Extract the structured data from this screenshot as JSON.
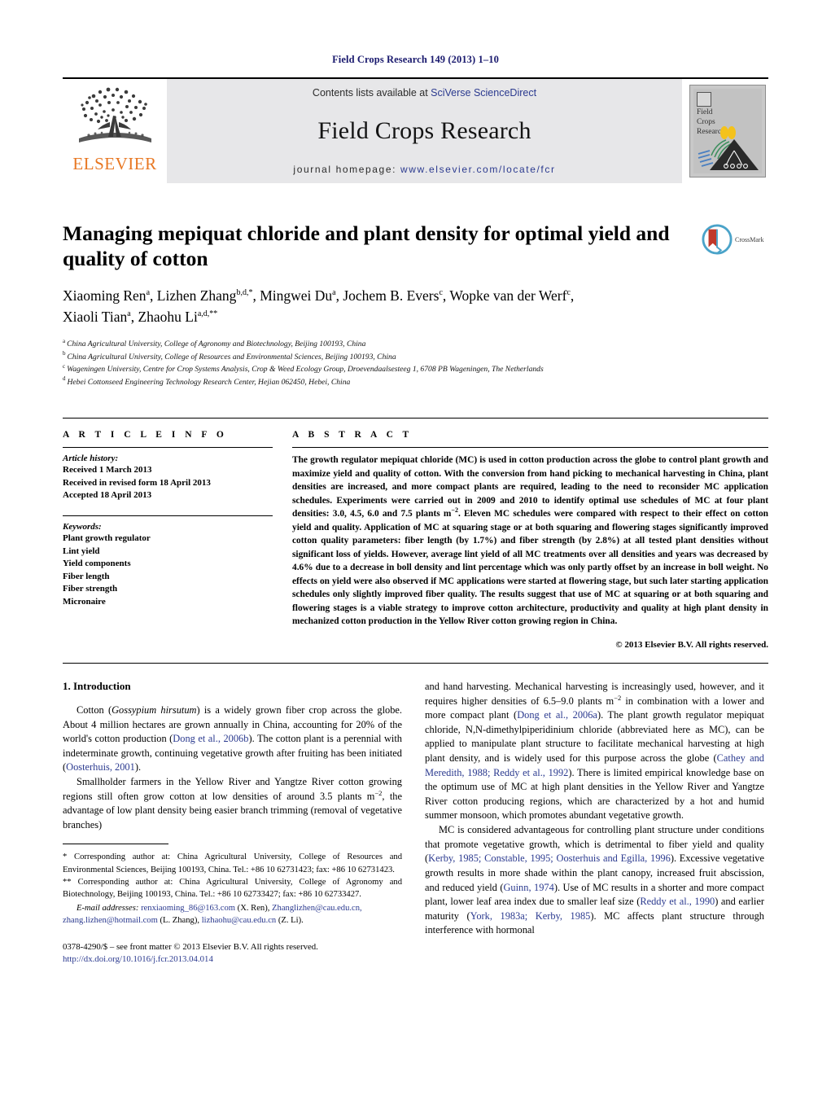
{
  "running_head": "Field Crops Research 149 (2013) 1–10",
  "masthead": {
    "publisher_name": "ELSEVIER",
    "contents_prefix": "Contents lists available at ",
    "contents_link": "SciVerse ScienceDirect",
    "journal_title": "Field Crops Research",
    "homepage_prefix": "journal homepage: ",
    "homepage_url": "www.elsevier.com/locate/fcr",
    "cover_title_line1": "Field",
    "cover_title_line2": "Crops",
    "cover_title_line3": "Research"
  },
  "article": {
    "title": "Managing mepiquat chloride and plant density for optimal yield and quality of cotton",
    "crossmark_label": "CrossMark",
    "authors_line1": "Xiaoming Ren|a|, Lizhen Zhang|b,d,*|, Mingwei Du|a|, Jochem B. Evers|c|, Wopke van der Werf|c|,",
    "authors_line2": "Xiaoli Tian|a|, Zhaohu Li|a,d,**|",
    "affiliations": [
      {
        "mark": "a",
        "text": "China Agricultural University, College of Agronomy and Biotechnology, Beijing 100193, China"
      },
      {
        "mark": "b",
        "text": "China Agricultural University, College of Resources and Environmental Sciences, Beijing 100193, China"
      },
      {
        "mark": "c",
        "text": "Wageningen University, Centre for Crop Systems Analysis, Crop & Weed Ecology Group, Droevendaalsesteeg 1, 6708 PB Wageningen, The Netherlands"
      },
      {
        "mark": "d",
        "text": "Hebei Cottonseed Engineering Technology Research Center, Hejian 062450, Hebei, China"
      }
    ]
  },
  "article_info": {
    "heading": "A R T I C L E  I N F O",
    "history_label": "Article history:",
    "history": [
      "Received 1 March 2013",
      "Received in revised form 18 April 2013",
      "Accepted 18 April 2013"
    ],
    "keywords_label": "Keywords:",
    "keywords": [
      "Plant growth regulator",
      "Lint yield",
      "Yield components",
      "Fiber length",
      "Fiber strength",
      "Micronaire"
    ]
  },
  "abstract": {
    "heading": "A B S T R A C T",
    "text_part1": "The growth regulator mepiquat chloride (MC) is used in cotton production across the globe to control plant growth and maximize yield and quality of cotton. With the conversion from hand picking to mechanical harvesting in China, plant densities are increased, and more compact plants are required, leading to the need to reconsider MC application schedules. Experiments were carried out in 2009 and 2010 to identify optimal use schedules of MC at four plant densities: 3.0, 4.5, 6.0 and 7.5 plants m",
    "sup1": "−2",
    "text_part2": ". Eleven MC schedules were compared with respect to their effect on cotton yield and quality. Application of MC at squaring stage or at both squaring and flowering stages significantly improved cotton quality parameters: fiber length (by 1.7%) and fiber strength (by 2.8%) at all tested plant densities without significant loss of yields. However, average lint yield of all MC treatments over all densities and years was decreased by 4.6% due to a decrease in boll density and lint percentage which was only partly offset by an increase in boll weight. No effects on yield were also observed if MC applications were started at flowering stage, but such later starting application schedules only slightly improved fiber quality. The results suggest that use of MC at squaring or at both squaring and flowering stages is a viable strategy to improve cotton architecture, productivity and quality at high plant density in mechanized cotton production in the Yellow River cotton growing region in China.",
    "copyright": "© 2013 Elsevier B.V. All rights reserved."
  },
  "introduction": {
    "heading": "1.  Introduction",
    "left": {
      "p1_a": "Cotton (",
      "p1_italic": "Gossypium hirsutum",
      "p1_b": ") is a widely grown fiber crop across the globe. About 4 million hectares are grown annually in China, accounting for 20% of the world's cotton production (",
      "p1_ref1": "Dong et al., 2006b",
      "p1_c": "). The cotton plant is a perennial with indeterminate growth, continuing vegetative growth after fruiting has been initiated (",
      "p1_ref2": "Oosterhuis, 2001",
      "p1_d": ").",
      "p2_a": "Smallholder farmers in the Yellow River and Yangtze River cotton growing regions still often grow cotton at low densities of around 3.5 plants m",
      "p2_sup": "−2",
      "p2_b": ", the advantage of low plant density being easier branch trimming (removal of vegetative branches)"
    },
    "right": {
      "p1_a": "and hand harvesting. Mechanical harvesting is increasingly used, however, and it requires higher densities of 6.5–9.0 plants m",
      "p1_sup": "−2",
      "p1_b": " in combination with a lower and more compact plant (",
      "p1_ref1": "Dong et al., 2006a",
      "p1_c": "). The plant growth regulator mepiquat chloride, N,N-dimethylpiperidinium chloride (abbreviated here as MC), can be applied to manipulate plant structure to facilitate mechanical harvesting at high plant density, and is widely used for this purpose across the globe (",
      "p1_ref2": "Cathey and Meredith, 1988; Reddy et al., 1992",
      "p1_d": "). There is limited empirical knowledge base on the optimum use of MC at high plant densities in the Yellow River and Yangtze River cotton producing regions, which are characterized by a hot and humid summer monsoon, which promotes abundant vegetative growth.",
      "p2_a": "MC is considered advantageous for controlling plant structure under conditions that promote vegetative growth, which is detrimental to fiber yield and quality (",
      "p2_ref1": "Kerby, 1985; Constable, 1995; Oosterhuis and Egilla, 1996",
      "p2_b": "). Excessive vegetative growth results in more shade within the plant canopy, increased fruit abscission, and reduced yield (",
      "p2_ref2": "Guinn, 1974",
      "p2_c": "). Use of MC results in a shorter and more compact plant, lower leaf area index due to smaller leaf size (",
      "p2_ref3": "Reddy et al., 1990",
      "p2_d": ") and earlier maturity (",
      "p2_ref4": "York, 1983a; Kerby, 1985",
      "p2_e": "). MC affects plant structure through interference with hormonal"
    }
  },
  "footnotes": {
    "corr1": "*  Corresponding author at: China Agricultural University, College of Resources and Environmental Sciences, Beijing 100193, China. Tel.: +86 10 62731423; fax: +86 10 62731423.",
    "corr2": "**  Corresponding author at: China Agricultural University, College of Agronomy and Biotechnology, Beijing 100193, China. Tel.: +86 10 62733427; fax: +86 10 62733427.",
    "email_label": "E-mail addresses:",
    "email1": "renxiaoming_86@163.com",
    "email1_who": " (X. Ren), ",
    "email2": "Zhanglizhen@cau.edu.cn,",
    "email3": "zhang.lizhen@hotmail.com",
    "email3_who": " (L. Zhang), ",
    "email4": "lizhaohu@cau.edu.cn",
    "email4_who": " (Z. Li)."
  },
  "issn_footer": {
    "line1": "0378-4290/$ – see front matter © 2013 Elsevier B.V. All rights reserved.",
    "doi": "http://dx.doi.org/10.1016/j.fcr.2013.04.014"
  },
  "colors": {
    "elsevier_orange": "#E87722",
    "link_blue": "#2b3a8f",
    "banner_gray": "#e7e7e9"
  }
}
